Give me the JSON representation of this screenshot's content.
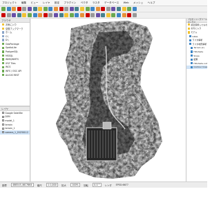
{
  "menu": [
    "プロジェクト",
    "編集",
    "ビュー",
    "レイヤ",
    "設定",
    "プラグイン",
    "ベクタ",
    "ラスタ",
    "データベース",
    "Web",
    "メッシュ",
    "ヘルプ"
  ],
  "toolbar_colors": [
    "#6aa84f",
    "#3d85c6",
    "#e69138",
    "#cc0000",
    "#999999",
    "#674ea7",
    "#45818e",
    "#f1c232"
  ],
  "left_panel": {
    "browser_title": "ブラウザ",
    "browser_items": [
      "お気に入り",
      "空間ブックマーク",
      "ホーム",
      "C:\\",
      "D:\\",
      "GeoPackage",
      "SpatiaLite",
      "PostgreSQL",
      "MSSQL",
      "WMS/WMTS",
      "XYZ Tiles",
      "WCS",
      "WFS / OGC API",
      "ArcGIS REST"
    ],
    "layers_title": "レイヤ",
    "layers": [
      "Google Satellite",
      "DEM",
      "model_1",
      "terrain",
      "terrain_1",
      "camera_1_20230112"
    ]
  },
  "right_panel": {
    "title": "プロセッシングツールボックス",
    "items": [
      "最近使用したもの",
      "お気に入り",
      "モデル",
      "GDAL",
      "ラスタ解析",
      "ラスタ地形解析",
      "Terrain (2)",
      "Hillshade",
      "Slope",
      "結果",
      "Hillshade-output",
      "Contour lines"
    ],
    "selected_index": 11
  },
  "status": {
    "coord_label": "座標",
    "coordinate": "488545,4617664",
    "scale_label": "縮尺",
    "scale": "1:1,000",
    "zoom_label": "拡大",
    "zoom": "100%",
    "rotation_label": "回転",
    "rotation": "0.0 °",
    "render_label": "レンダ",
    "crs": "EPSG:6677"
  }
}
